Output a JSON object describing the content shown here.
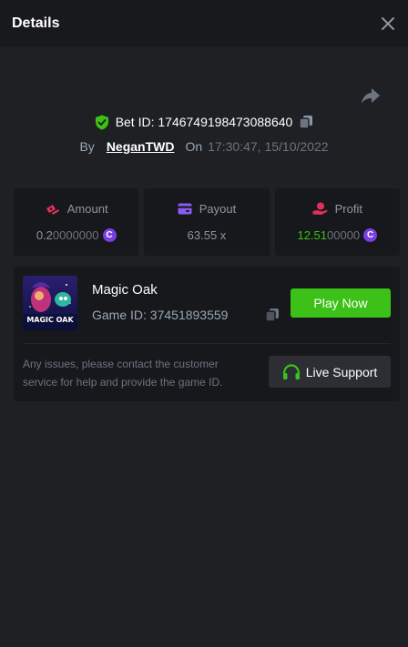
{
  "header": {
    "title": "Details"
  },
  "bet": {
    "id_label": "Bet ID:",
    "id": "1746749198473088640",
    "by_label": "By",
    "user": "NeganTWD",
    "on_label": "On",
    "timestamp": "17:30:47, 15/10/2022"
  },
  "stats": {
    "amount": {
      "label": "Amount",
      "value_main": "0.2",
      "value_trail": "0000000",
      "coin": "C"
    },
    "payout": {
      "label": "Payout",
      "value": "63.55 x"
    },
    "profit": {
      "label": "Profit",
      "value_main": "12.51",
      "value_trail": "00000",
      "coin": "C"
    }
  },
  "game": {
    "name": "Magic Oak",
    "id_label": "Game ID:",
    "id": "37451893559",
    "thumb_text": "MAGIC OAK",
    "play_label": "Play Now"
  },
  "support": {
    "notice": "Any issues, please contact the customer service for help and provide the game ID.",
    "button_label": "Live Support"
  },
  "colors": {
    "accent_green": "#3bc117",
    "coin_purple": "#7a3fe0",
    "panel_bg": "#17181b",
    "page_bg": "#1f2024"
  },
  "icons": {
    "close": "close-icon",
    "share": "share-icon",
    "shield": "shield-check-icon",
    "copy": "copy-icon",
    "amount": "bet-chips-icon",
    "payout": "card-icon",
    "profit": "hand-coin-icon",
    "coin": "coin-icon",
    "support": "headset-icon"
  }
}
